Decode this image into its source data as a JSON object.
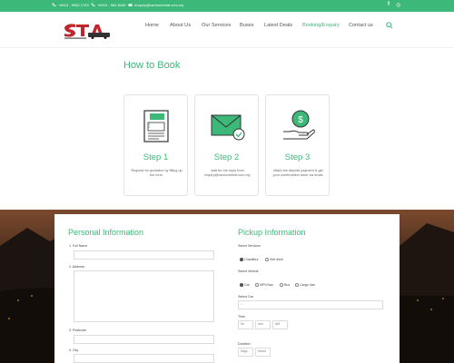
{
  "topbar": {
    "phone1": "+6013 - 9082 1763",
    "phone2": "+6019 - 984 8445",
    "email": "enquiry@cantourental.com.my",
    "social": [
      "f",
      "◎"
    ]
  },
  "nav": {
    "items": [
      {
        "label": "Home"
      },
      {
        "label": "About Us"
      },
      {
        "label": "Our Services"
      },
      {
        "label": "Buses"
      },
      {
        "label": "Latest Deals"
      },
      {
        "label": "Booking/Enquiry"
      },
      {
        "label": "Contact us"
      }
    ]
  },
  "colors": {
    "accent": "#3cb878",
    "brand_red": "#c0262c"
  },
  "how_to_book": {
    "title": "How to Book",
    "steps": [
      {
        "title": "Step 1",
        "desc": "Request for quotation by filling up the form.",
        "icon": "form-document-icon"
      },
      {
        "title": "Step 2",
        "desc": "wait for the reply from inquiry@cantourental.com.my",
        "icon": "envelope-check-icon"
      },
      {
        "title": "Step 3",
        "desc": "Make the deposit payment & get your confirmation done via email.",
        "icon": "hand-coin-icon"
      }
    ]
  },
  "personal": {
    "title": "Personal Information",
    "fields": [
      {
        "label": "1. Full Name"
      },
      {
        "label": "2. Address"
      },
      {
        "label": "3. Postcode"
      },
      {
        "label": "4. City"
      }
    ]
  },
  "pickup": {
    "title": "Pickup Information",
    "select_services": {
      "label": "Select Services",
      "options": [
        "Chauffeur",
        "Self drive"
      ],
      "selected": "Chauffeur"
    },
    "select_vehicle": {
      "label": "Select Vehicle",
      "options": [
        "Car",
        "MPV/Van",
        "Bus",
        "Cargo Van"
      ],
      "selected": "Car"
    },
    "select_car": {
      "label": "Select Car",
      "value": "--"
    },
    "time": {
      "label": "Time",
      "hh": "hh",
      "mm": "mm",
      "ampm": "AM"
    },
    "duration": {
      "label": "Duration",
      "days": "Days",
      "hours": "Hours"
    }
  }
}
